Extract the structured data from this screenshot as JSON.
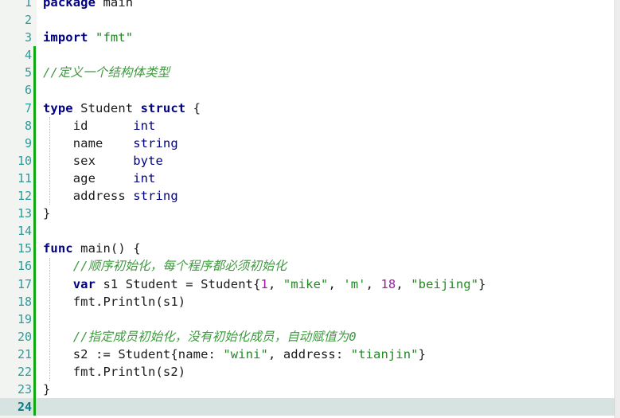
{
  "editor": {
    "language": "go",
    "current_line": 24,
    "first_visible_line": 1,
    "last_visible_line": 24,
    "colors": {
      "background": "#ffffff",
      "gutter_background": "#f2f4f2",
      "line_number": "#2e9a9a",
      "current_line_highlight": "#d7e3e0",
      "change_bar": "#11a811",
      "keyword": "#000080",
      "type": "#000080",
      "string": "#208a20",
      "comment": "#3f9a3f",
      "number": "#9a1f9a",
      "text": "#1a1a1a",
      "fold_triangle": "#8fb7b5"
    },
    "gutter": {
      "line_numbers": [
        "1",
        "2",
        "3",
        "4",
        "5",
        "6",
        "7",
        "8",
        "9",
        "10",
        "11",
        "12",
        "13",
        "14",
        "15",
        "16",
        "17",
        "18",
        "19",
        "20",
        "21",
        "22",
        "23",
        "24"
      ],
      "fold_markers": [
        7,
        15
      ]
    },
    "lines": [
      {
        "n": 1,
        "text": "package main",
        "tokens": [
          {
            "t": "package",
            "c": "kw"
          },
          {
            "t": " ",
            "c": "plain"
          },
          {
            "t": "main",
            "c": "plain"
          }
        ]
      },
      {
        "n": 2,
        "text": "",
        "tokens": []
      },
      {
        "n": 3,
        "text": "import \"fmt\"",
        "tokens": [
          {
            "t": "import",
            "c": "kw"
          },
          {
            "t": " ",
            "c": "plain"
          },
          {
            "t": "\"fmt\"",
            "c": "str"
          }
        ]
      },
      {
        "n": 4,
        "text": "",
        "tokens": []
      },
      {
        "n": 5,
        "text": "//定义一个结构体类型",
        "tokens": [
          {
            "t": "//定义一个结构体类型",
            "c": "cmt"
          }
        ]
      },
      {
        "n": 6,
        "text": "",
        "tokens": []
      },
      {
        "n": 7,
        "text": "type Student struct {",
        "tokens": [
          {
            "t": "type",
            "c": "kw"
          },
          {
            "t": " Student ",
            "c": "plain"
          },
          {
            "t": "struct",
            "c": "kw"
          },
          {
            "t": " {",
            "c": "punct"
          }
        ]
      },
      {
        "n": 8,
        "text": "    id      int",
        "tokens": [
          {
            "t": "    id      ",
            "c": "plain"
          },
          {
            "t": "int",
            "c": "typ"
          }
        ]
      },
      {
        "n": 9,
        "text": "    name    string",
        "tokens": [
          {
            "t": "    name    ",
            "c": "plain"
          },
          {
            "t": "string",
            "c": "typ"
          }
        ]
      },
      {
        "n": 10,
        "text": "    sex     byte",
        "tokens": [
          {
            "t": "    sex     ",
            "c": "plain"
          },
          {
            "t": "byte",
            "c": "typ"
          }
        ]
      },
      {
        "n": 11,
        "text": "    age     int",
        "tokens": [
          {
            "t": "    age     ",
            "c": "plain"
          },
          {
            "t": "int",
            "c": "typ"
          }
        ]
      },
      {
        "n": 12,
        "text": "    address string",
        "tokens": [
          {
            "t": "    address ",
            "c": "plain"
          },
          {
            "t": "string",
            "c": "typ"
          }
        ]
      },
      {
        "n": 13,
        "text": "}",
        "tokens": [
          {
            "t": "}",
            "c": "punct"
          }
        ]
      },
      {
        "n": 14,
        "text": "",
        "tokens": []
      },
      {
        "n": 15,
        "text": "func main() {",
        "tokens": [
          {
            "t": "func",
            "c": "kw"
          },
          {
            "t": " main() {",
            "c": "plain"
          }
        ]
      },
      {
        "n": 16,
        "text": "    //顺序初始化，每个程序都必须初始化",
        "tokens": [
          {
            "t": "    ",
            "c": "plain"
          },
          {
            "t": "//顺序初始化，每个程序都必须初始化",
            "c": "cmt"
          }
        ]
      },
      {
        "n": 17,
        "text": "    var s1 Student = Student{1, \"mike\", 'm', 18, \"beijing\"}",
        "tokens": [
          {
            "t": "    ",
            "c": "plain"
          },
          {
            "t": "var",
            "c": "kw"
          },
          {
            "t": " s1 Student = Student{",
            "c": "plain"
          },
          {
            "t": "1",
            "c": "num"
          },
          {
            "t": ", ",
            "c": "punct"
          },
          {
            "t": "\"mike\"",
            "c": "str"
          },
          {
            "t": ", ",
            "c": "punct"
          },
          {
            "t": "'m'",
            "c": "str"
          },
          {
            "t": ", ",
            "c": "punct"
          },
          {
            "t": "18",
            "c": "num"
          },
          {
            "t": ", ",
            "c": "punct"
          },
          {
            "t": "\"beijing\"",
            "c": "str"
          },
          {
            "t": "}",
            "c": "punct"
          }
        ]
      },
      {
        "n": 18,
        "text": "    fmt.Println(s1)",
        "tokens": [
          {
            "t": "    fmt.Println(s1)",
            "c": "plain"
          }
        ]
      },
      {
        "n": 19,
        "text": "",
        "tokens": []
      },
      {
        "n": 20,
        "text": "    //指定成员初始化，没有初始化成员，自动赋值为0",
        "tokens": [
          {
            "t": "    ",
            "c": "plain"
          },
          {
            "t": "//指定成员初始化，没有初始化成员，自动赋值为0",
            "c": "cmt"
          }
        ]
      },
      {
        "n": 21,
        "text": "    s2 := Student{name: \"wini\", address: \"tianjin\"}",
        "tokens": [
          {
            "t": "    s2 := Student{name: ",
            "c": "plain"
          },
          {
            "t": "\"wini\"",
            "c": "str"
          },
          {
            "t": ", address: ",
            "c": "plain"
          },
          {
            "t": "\"tianjin\"",
            "c": "str"
          },
          {
            "t": "}",
            "c": "punct"
          }
        ]
      },
      {
        "n": 22,
        "text": "    fmt.Println(s2)",
        "tokens": [
          {
            "t": "    fmt.Println(s2)",
            "c": "plain"
          }
        ]
      },
      {
        "n": 23,
        "text": "}",
        "tokens": [
          {
            "t": "}",
            "c": "punct"
          }
        ]
      },
      {
        "n": 24,
        "text": "",
        "tokens": []
      }
    ]
  }
}
